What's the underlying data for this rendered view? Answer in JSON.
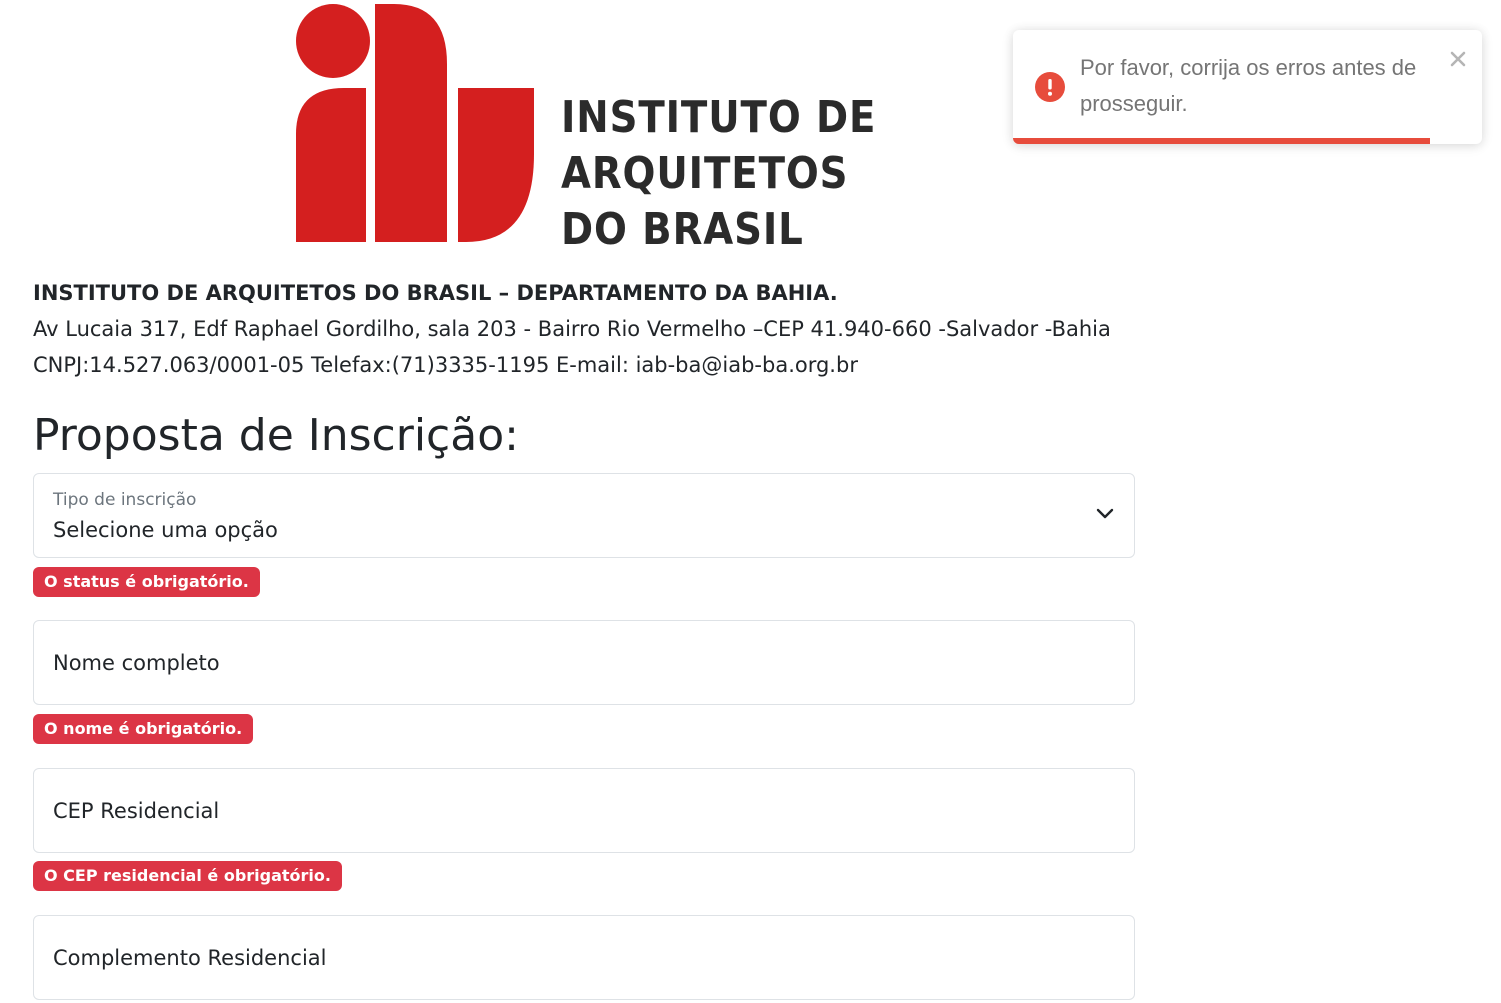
{
  "logo": {
    "line1": "INSTITUTO DE",
    "line2": "ARQUITETOS",
    "line3": "DO BRASIL",
    "brand_color": "#d41f1f"
  },
  "org_info": {
    "title": "INSTITUTO DE ARQUITETOS DO BRASIL – DEPARTAMENTO DA BAHIA.",
    "address": "Av Lucaia 317, Edf Raphael Gordilho, sala 203 - Bairro Rio Vermelho –CEP 41.940-660 -Salvador -Bahia",
    "contact": "CNPJ:14.527.063/0001-05 Telefax:(71)3335-1195 E-mail: iab-ba@iab-ba.org.br"
  },
  "form": {
    "title": "Proposta de Inscrição:",
    "tipo_inscricao": {
      "label": "Tipo de inscrição",
      "selected": "Selecione uma opção",
      "error": "O status é obrigatório."
    },
    "nome": {
      "placeholder": "Nome completo",
      "error": "O nome é obrigatório."
    },
    "cep": {
      "placeholder": "CEP Residencial",
      "error": "O CEP residencial é obrigatório."
    },
    "complemento": {
      "placeholder": "Complemento Residencial"
    }
  },
  "toast": {
    "message": "Por favor, corrija os erros antes de prosseguir.",
    "icon": "error-circle-icon",
    "close_icon": "close-icon",
    "progress_percent": 89,
    "accent_color": "#e74c3c"
  },
  "colors": {
    "error_badge": "#dc3545",
    "text": "#212529",
    "muted": "#6c757d",
    "border": "#dee2e6"
  }
}
